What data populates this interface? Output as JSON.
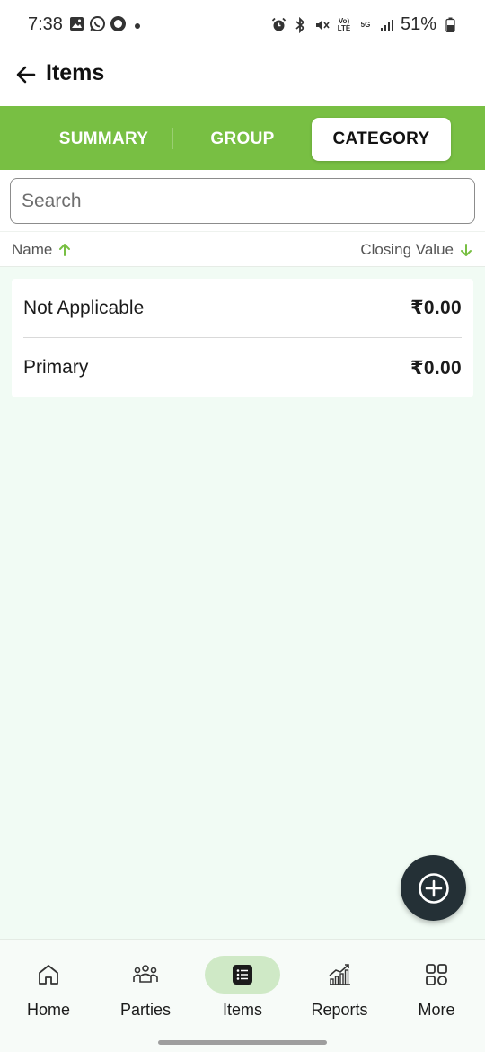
{
  "status_bar": {
    "time": "7:38",
    "battery": "51%",
    "icons_left": [
      "gallery-icon",
      "whatsapp-icon",
      "record-icon",
      "notification-dot"
    ],
    "icons_right": [
      "alarm-icon",
      "bluetooth-icon",
      "mute-icon",
      "volte-icon",
      "5g-icon",
      "signal-icon",
      "battery-icon"
    ],
    "volte_label": "Vo) LTE",
    "fiveg_label": "5G"
  },
  "app_bar": {
    "title": "Items"
  },
  "tabs": [
    {
      "label": "SUMMARY",
      "active": false
    },
    {
      "label": "GROUP",
      "active": false
    },
    {
      "label": "CATEGORY",
      "active": true
    }
  ],
  "search": {
    "placeholder": "Search",
    "value": ""
  },
  "columns": {
    "name": "Name",
    "value": "Closing Value"
  },
  "rows": [
    {
      "name": "Not Applicable",
      "value": "₹0.00"
    },
    {
      "name": "Primary",
      "value": "₹0.00"
    }
  ],
  "bottom_nav": [
    {
      "label": "Home",
      "icon": "home-icon",
      "active": false
    },
    {
      "label": "Parties",
      "icon": "people-icon",
      "active": false
    },
    {
      "label": "Items",
      "icon": "list-icon",
      "active": true
    },
    {
      "label": "Reports",
      "icon": "chart-icon",
      "active": false
    },
    {
      "label": "More",
      "icon": "grid-icon",
      "active": false
    }
  ],
  "colors": {
    "brand_green": "#78bf43",
    "active_nav_bg": "#cfe9c6",
    "fab_bg": "#243036",
    "page_bg": "#f1fbf4"
  }
}
